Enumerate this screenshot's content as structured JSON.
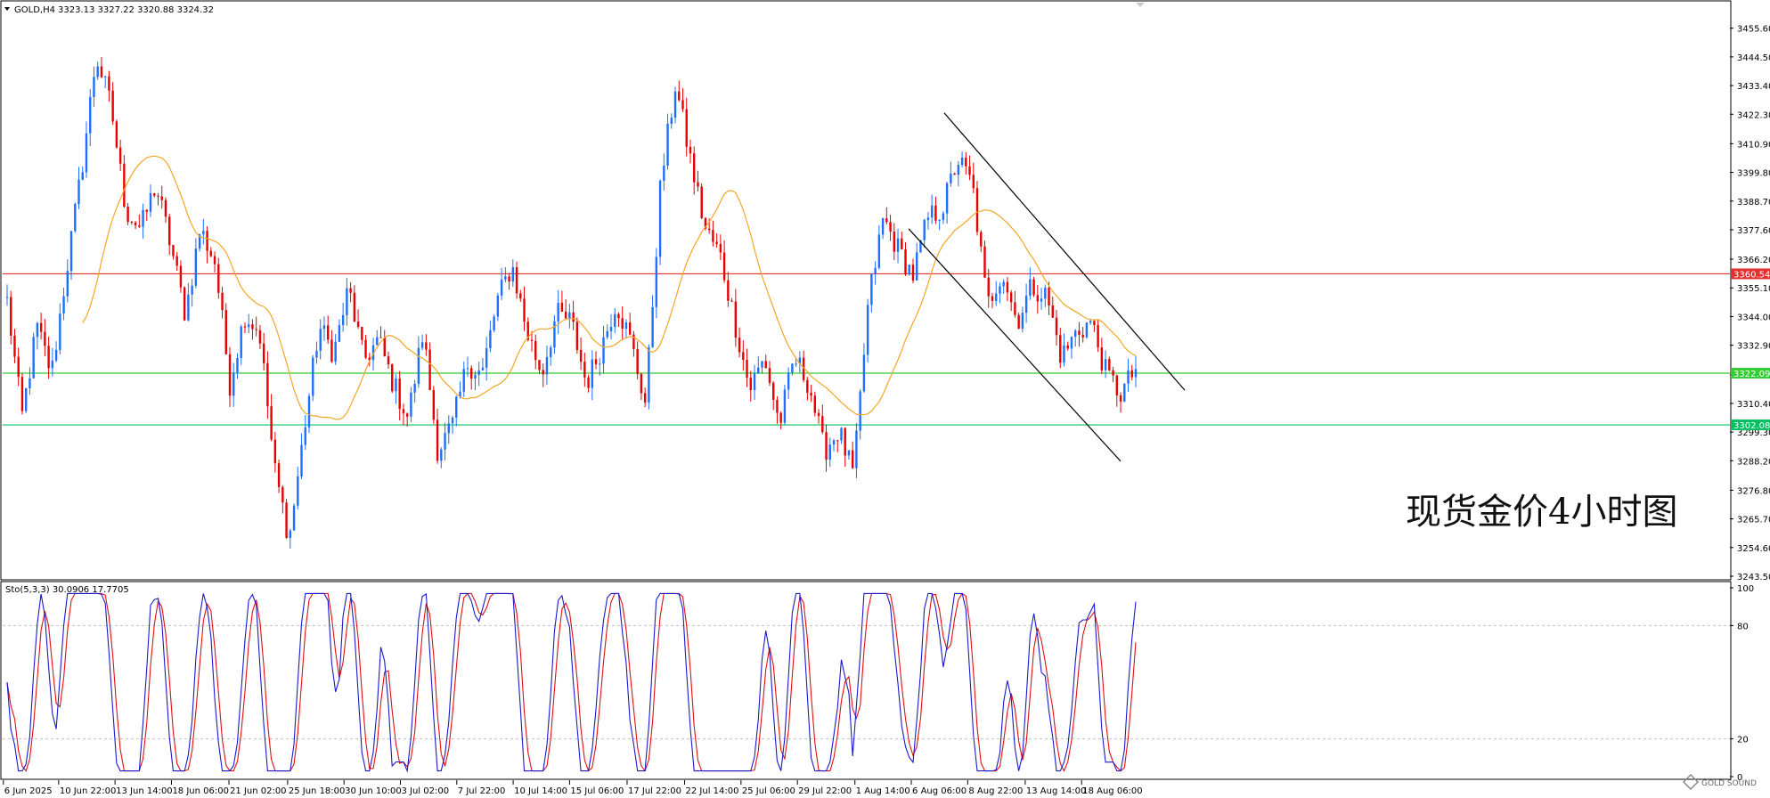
{
  "header": {
    "symbol": "GOLD,H4",
    "ohlc": "3323.13 3327.22 3320.88 3324.32"
  },
  "watermark": "现货金价4小时图",
  "logo_text": "GOLD SOUND",
  "stoch_header": "Sto(5,3,3) 30.0906 17.7705",
  "colors": {
    "bull": "#1e6fff",
    "bear": "#e60000",
    "ma": "#f5a623",
    "resistance": "#e03030",
    "support": "#33cc33",
    "support2": "#00c060",
    "stoch_main": "#1a1acc",
    "stoch_signal": "#e01010"
  },
  "chart_data": [
    {
      "type": "candlestick",
      "title": "GOLD,H4",
      "ylim": [
        3243.5,
        3461.0
      ],
      "y_ticks": [
        "3455.60",
        "3444.50",
        "3433.40",
        "3422.30",
        "3410.90",
        "3399.80",
        "3388.70",
        "3377.60",
        "3366.20",
        "3355.10",
        "3344.00",
        "3332.90",
        "3321.50",
        "3310.40",
        "3299.30",
        "3288.20",
        "3276.80",
        "3265.70",
        "3254.60",
        "3243.50"
      ],
      "x_ticks": [
        "6 Jun 2025",
        "10 Jun 22:00",
        "13 Jun 14:00",
        "18 Jun 06:00",
        "21 Jun 02:00",
        "25 Jun 18:00",
        "30 Jun 10:00",
        "3 Jul 02:00",
        "7 Jul 22:00",
        "10 Jul 14:00",
        "15 Jul 06:00",
        "17 Jul 22:00",
        "22 Jul 14:00",
        "25 Jul 06:00",
        "29 Jul 22:00",
        "1 Aug 14:00",
        "6 Aug 06:00",
        "8 Aug 22:00",
        "13 Aug 14:00",
        "18 Aug 06:00"
      ],
      "price_path": [
        3350,
        3305,
        3340,
        3322,
        3362,
        3400,
        3445,
        3425,
        3385,
        3378,
        3395,
        3372,
        3345,
        3378,
        3365,
        3318,
        3345,
        3338,
        3285,
        3258,
        3300,
        3340,
        3330,
        3355,
        3327,
        3335,
        3318,
        3305,
        3338,
        3292,
        3302,
        3326,
        3322,
        3350,
        3364,
        3338,
        3322,
        3345,
        3342,
        3318,
        3332,
        3350,
        3334,
        3310,
        3395,
        3434,
        3405,
        3378,
        3368,
        3342,
        3316,
        3328,
        3302,
        3328,
        3318,
        3292,
        3300,
        3282,
        3350,
        3382,
        3370,
        3360,
        3382,
        3386,
        3405,
        3395,
        3348,
        3362,
        3342,
        3356,
        3352,
        3328,
        3338,
        3342,
        3322,
        3314,
        3324
      ],
      "horizontal_levels": [
        {
          "value": 3360.54,
          "label": "3360.54",
          "color": "#e03030"
        },
        {
          "value": 3322.09,
          "label": "3322.09",
          "color": "#33cc33"
        },
        {
          "value": 3302.08,
          "label": "3302.08",
          "color": "#00c060"
        }
      ],
      "channel": {
        "from_bar": 840,
        "to_bar": 1050,
        "upper": [
          3422.8,
          3315.5
        ],
        "lower": [
          3378.0,
          3288.0
        ]
      },
      "moving_average": "orange"
    },
    {
      "type": "line",
      "title": "Sto(5,3,3) 30.0906 17.7705",
      "ylim": [
        0,
        100
      ],
      "y_ticks": [
        "100",
        "80",
        "20",
        "0"
      ],
      "levels": [
        80,
        20
      ],
      "series": [
        {
          "name": "main"
        },
        {
          "name": "signal"
        }
      ]
    }
  ]
}
